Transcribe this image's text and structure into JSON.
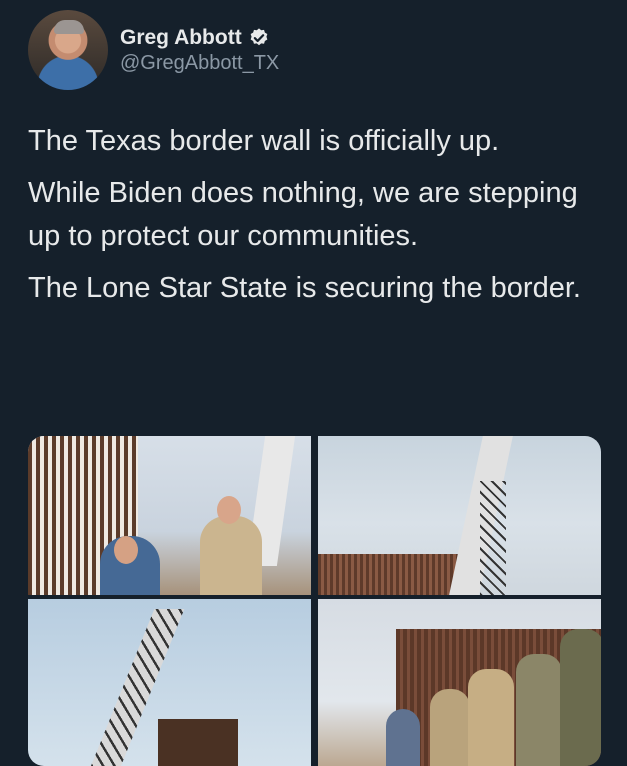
{
  "tweet": {
    "author": {
      "display_name": "Greg Abbott",
      "handle": "@GregAbbott_TX",
      "verified_icon": "verified-badge-icon"
    },
    "paragraphs": [
      "The Texas border wall is officially up.",
      "While Biden does nothing, we are stepping up to protect our communities.",
      "The Lone Star State is securing the border."
    ],
    "media_count": 4
  },
  "colors": {
    "background": "#15202b",
    "text": "#e7e9ea",
    "secondary_text": "#8b98a5"
  }
}
